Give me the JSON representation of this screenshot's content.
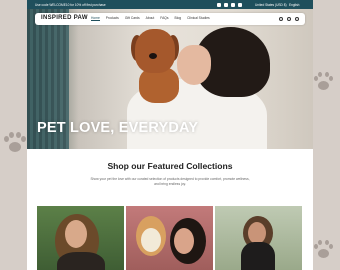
{
  "announcement": {
    "message": "Use code WELCOME10 for 10% off first purchase",
    "region": "United States (USD $)",
    "language": "English"
  },
  "nav": {
    "logo": "INSPIRED PAW",
    "menu": [
      "Home",
      "Products",
      "Gift Cards",
      "About",
      "FAQs",
      "Blog",
      "Clinical Studies"
    ],
    "active": "Home",
    "icons": [
      "search-icon",
      "account-icon",
      "cart-icon"
    ]
  },
  "hero": {
    "title": "PET LOVE, EVERYDAY"
  },
  "featured": {
    "title": "Shop our Featured Collections",
    "description": "Show your pet the love with our curated selection of products designed to provide comfort, promote wellness, and bring endless joy."
  },
  "colors": {
    "brand": "#1f4f5c",
    "background": "#d6cec8"
  }
}
